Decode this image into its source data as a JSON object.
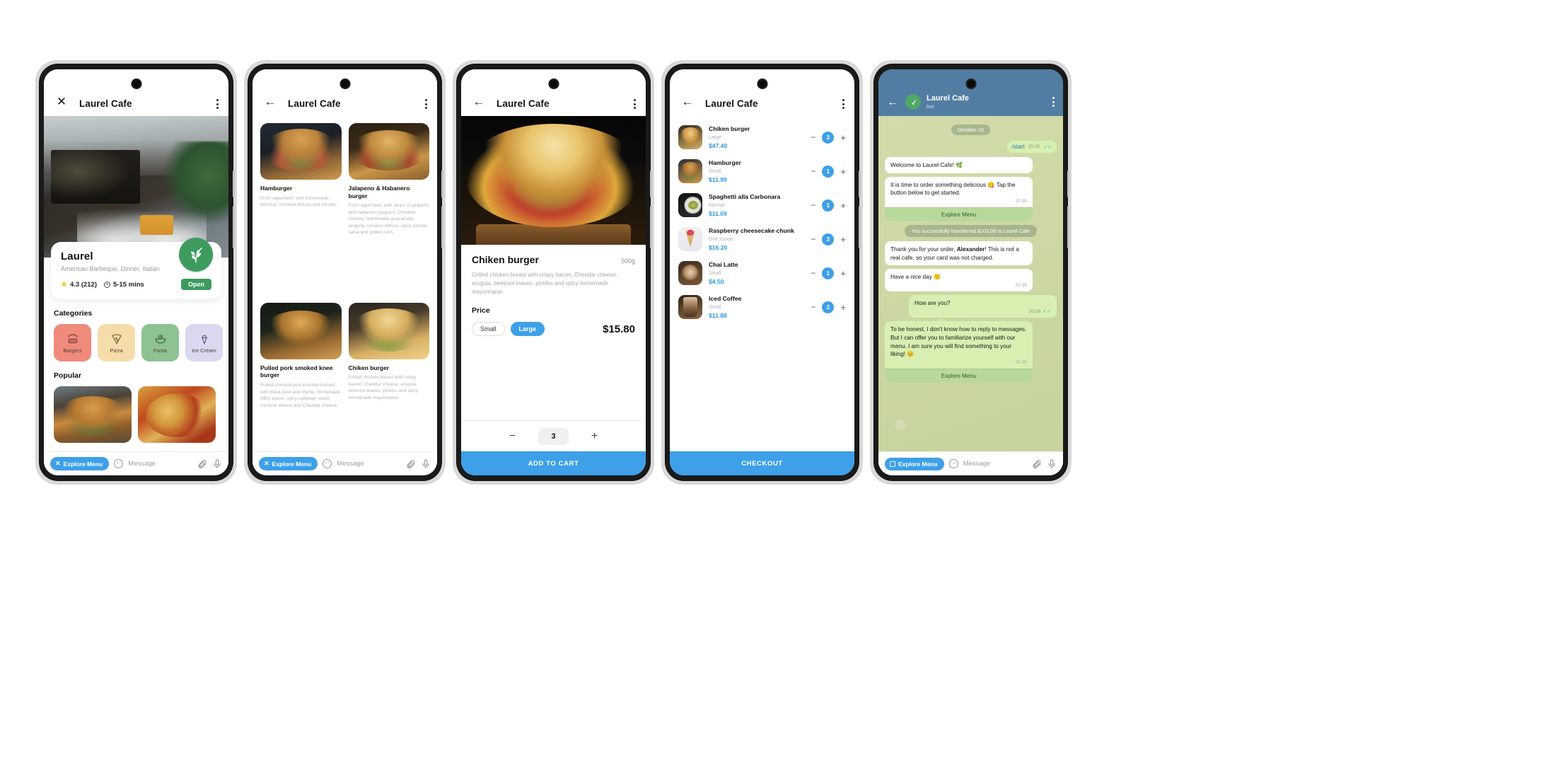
{
  "brand": {
    "name": "Laurel Cafe",
    "accent": "#3ea0e8",
    "green": "#3e9b5f",
    "telegram_header": "#527da3"
  },
  "phone1": {
    "header": {
      "close_icon": "close-icon",
      "title": "Laurel Cafe",
      "menu_icon": "more-vertical-icon"
    },
    "restaurant": {
      "name": "Laurel",
      "tags": "American Barbeque, Dinner, Italian",
      "rating": "4.3 (212)",
      "delivery_time": "5-15 mins",
      "status": "Open"
    },
    "categories_title": "Categories",
    "categories": [
      {
        "label": "Burgers",
        "color": "#f08a7a",
        "icon": "burger-icon"
      },
      {
        "label": "Pizza",
        "color": "#f5dcab",
        "icon": "pizza-icon"
      },
      {
        "label": "Pasta",
        "color": "#8dc292",
        "icon": "noodle-bowl-icon"
      },
      {
        "label": "Ice Cream",
        "color": "#d9d8ef",
        "icon": "ice-cream-icon"
      },
      {
        "label": "",
        "color": "#f0c97a",
        "icon": "more-icon"
      }
    ],
    "popular_title": "Popular",
    "popular": [
      {
        "name": "burger-photo"
      },
      {
        "name": "pizza-photo"
      }
    ],
    "bottom": {
      "explore": "Explore Menu",
      "message_placeholder": "Message"
    }
  },
  "phone2": {
    "header": {
      "back_icon": "back-arrow-icon",
      "title": "Laurel Cafe",
      "menu_icon": "more-vertical-icon"
    },
    "items": [
      {
        "name": "Hamburger",
        "desc": "From aged beef, with homemade ketchup, romaine lettuce and tomato.",
        "img": "hamburger-photo"
      },
      {
        "name": "Jalapeno & Habanero burger",
        "desc": "From aged beef, with slices of jalapeño and habanero peppers, Cheddar cheese, homemade guacamole, arugula, romaine lettuce, spicy tomato salsa and grilled corn.",
        "img": "jalapeno-burger-photo"
      },
      {
        "name": "Pulled pork smoked knee burger",
        "desc": "Pulled smoked pork knuckle braised with black beer and thyme, homemade BBQ sauce, spicy cabbage salad, romaine lettuce and Cheddar cheese.",
        "img": "pulled-pork-photo"
      },
      {
        "name": "Chiken burger",
        "desc": "Grilled chicken breast with crispy bacon, Cheddar cheese, arugula, beetroot leaves, pickles and spicy homemade mayonnaise.",
        "img": "chicken-burger-photo"
      }
    ],
    "bottom": {
      "explore": "Explore Menu",
      "message_placeholder": "Message"
    }
  },
  "phone3": {
    "header": {
      "back_icon": "back-arrow-icon",
      "title": "Laurel Cafe",
      "menu_icon": "more-vertical-icon"
    },
    "product": {
      "name": "Chiken burger",
      "weight": "500g",
      "desc": "Grilled chicken breast with crispy bacon, Cheddar cheese, arugula, beetroot leaves, pickles and spicy homemade mayonnaise.",
      "price_label": "Price",
      "sizes": [
        {
          "label": "Small",
          "selected": false
        },
        {
          "label": "Large",
          "selected": true
        }
      ],
      "price": "$15.80",
      "quantity": "3",
      "minus": "−",
      "plus": "+",
      "cta": "ADD TO CART"
    }
  },
  "phone4": {
    "header": {
      "back_icon": "back-arrow-icon",
      "title": "Laurel Cafe",
      "menu_icon": "more-vertical-icon"
    },
    "cart": [
      {
        "name": "Chiken burger",
        "option": "Large",
        "price": "$47.40",
        "qty": "3",
        "img": "chicken-burger-thumb"
      },
      {
        "name": "Hamburger",
        "option": "Small",
        "price": "$11.99",
        "qty": "1",
        "img": "hamburger-thumb"
      },
      {
        "name": "Spaghetti alla Carbonara",
        "option": "Normal",
        "price": "$11.09",
        "qty": "1",
        "img": "spaghetti-thumb"
      },
      {
        "name": "Raspberry cheesecake chunk",
        "option": "One scoop",
        "price": "$16.20",
        "qty": "3",
        "img": "cheesecake-thumb"
      },
      {
        "name": "Chai Latte",
        "option": "Small",
        "price": "$4.50",
        "qty": "1",
        "img": "chai-latte-thumb"
      },
      {
        "name": "Iced Coffee",
        "option": "Small",
        "price": "$11.88",
        "qty": "2",
        "img": "iced-coffee-thumb"
      }
    ],
    "checkout": "CHECKOUT"
  },
  "phone5": {
    "header": {
      "back_icon": "back-arrow-icon",
      "title": "Laurel Cafe",
      "subtitle": "bot",
      "menu_icon": "more-vertical-icon"
    },
    "date_divider": "October 10",
    "messages": [
      {
        "type": "command",
        "text": "/start",
        "time": "20:35",
        "ticks": true
      },
      {
        "type": "in",
        "text": "Welcome to Laurel Cafe! 🌿",
        "time": "",
        "button": ""
      },
      {
        "type": "in",
        "text": "It is time to order something delicious 😋 Tap the button below to get started.",
        "time": "20:35",
        "button": "Explore Menu"
      },
      {
        "type": "system",
        "text": "You successfully transferred $103.06 to Laurel Cafe"
      },
      {
        "type": "in",
        "text": "Thank you for your order, Alexander! This is not a real cafe, so your card was not charged.",
        "time": ""
      },
      {
        "type": "in",
        "text": "Have a nice day 🙂",
        "time": "20:39"
      },
      {
        "type": "out",
        "text": "How are you?",
        "time": "20:39",
        "ticks": true
      },
      {
        "type": "in",
        "text": "To be honest, I don't know how to reply to messages. But I can offer you to familiarize yourself with our menu. I am sure you will find something to your liking! 😊",
        "time": "20:39",
        "button": "Explore Menu"
      }
    ],
    "bottom": {
      "explore": "Explore Menu",
      "message_placeholder": "Message"
    }
  }
}
